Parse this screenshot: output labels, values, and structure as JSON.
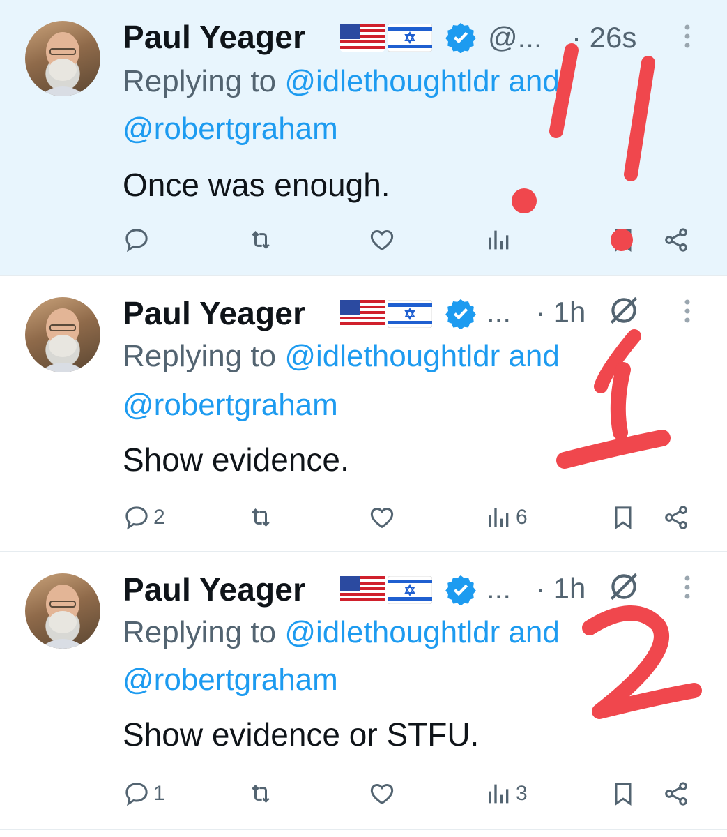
{
  "tweets": [
    {
      "name": "Paul Yeager",
      "handle": "@...",
      "time": "· 26s",
      "reply_prefix": "Replying to ",
      "mention1": "@idlethoughtldr",
      "and_word": " and",
      "mention2": "@robertgraham",
      "text": "Once was enough.",
      "replies": "",
      "views": ""
    },
    {
      "name": "Paul Yeager",
      "handle": "...",
      "time": "· 1h",
      "reply_prefix": "Replying to ",
      "mention1": "@idlethoughtldr",
      "and_word": " and",
      "mention2": "@robertgraham",
      "text": "Show evidence.",
      "replies": "2",
      "views": "6"
    },
    {
      "name": "Paul Yeager",
      "handle": "...",
      "time": "· 1h",
      "reply_prefix": "Replying to ",
      "mention1": "@idlethoughtldr",
      "and_word": " and",
      "mention2": "@robertgraham",
      "text": "Show evidence or STFU.",
      "replies": "1",
      "views": "3"
    }
  ],
  "icons": {
    "reply": "reply-icon",
    "retweet": "retweet-icon",
    "like": "like-icon",
    "views": "views-icon",
    "bookmark": "bookmark-icon",
    "share": "share-icon",
    "more": "more-icon",
    "verified": "verified-badge-icon",
    "grok": "grok-icon"
  },
  "colors": {
    "highlight_bg": "#e8f5fd",
    "mention": "#1d9bf0",
    "secondary_text": "#536471",
    "annotation_red": "#f0474d"
  },
  "annotations": [
    "!!",
    "1",
    "2"
  ]
}
